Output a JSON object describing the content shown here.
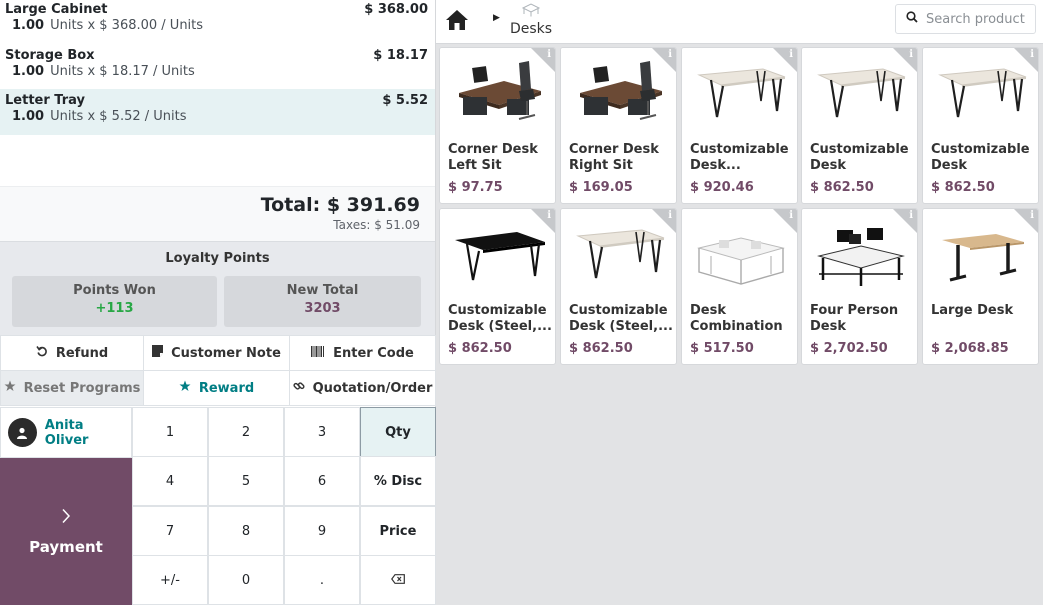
{
  "order": {
    "lines": [
      {
        "name": "Large Cabinet",
        "qty": "1.00",
        "unit_text": "Units x $ 368.00 / Units",
        "price": "$ 368.00"
      },
      {
        "name": "Storage Box",
        "qty": "1.00",
        "unit_text": "Units x $ 18.17 / Units",
        "price": "$ 18.17"
      },
      {
        "name": "Letter Tray",
        "qty": "1.00",
        "unit_text": "Units x $ 5.52 / Units",
        "price": "$ 5.52"
      }
    ],
    "selected_line": "Letter Tray",
    "total": "Total: $ 391.69",
    "taxes": "Taxes: $ 51.09"
  },
  "loyalty": {
    "title": "Loyalty Points",
    "points_won_label": "Points Won",
    "points_won_value": "+113",
    "new_total_label": "New Total",
    "new_total_value": "3203"
  },
  "controls": {
    "refund": "Refund",
    "customer_note": "Customer Note",
    "enter_code": "Enter Code",
    "reset_programs": "Reset Programs",
    "reward": "Reward",
    "quotation_order": "Quotation/Order"
  },
  "customer": {
    "name": "Anita Oliver"
  },
  "payment": {
    "label": "Payment"
  },
  "numpad": {
    "k1": "1",
    "k2": "2",
    "k3": "3",
    "qty": "Qty",
    "k4": "4",
    "k5": "5",
    "k6": "6",
    "disc": "% Disc",
    "k7": "7",
    "k8": "8",
    "k9": "9",
    "price": "Price",
    "plusminus": "+/-",
    "k0": "0",
    "dot": ".",
    "active_mode": "Qty"
  },
  "header": {
    "category": "Desks",
    "search_placeholder": "Search product"
  },
  "products": [
    {
      "name": "Corner Desk Left Sit",
      "price": "$ 97.75",
      "icon": "corner-desk-image"
    },
    {
      "name": "Corner Desk Right Sit",
      "price": "$ 169.05",
      "icon": "corner-desk-image"
    },
    {
      "name": "Customizable Desk...",
      "price": "$ 920.46",
      "icon": "desk-image"
    },
    {
      "name": "Customizable Desk (Custom...",
      "price": "$ 862.50",
      "icon": "desk-image"
    },
    {
      "name": "Customizable Desk (Custom...",
      "price": "$ 862.50",
      "icon": "desk-image"
    },
    {
      "name": "Customizable Desk (Steel,...",
      "price": "$ 862.50",
      "icon": "black-desk-image"
    },
    {
      "name": "Customizable Desk (Steel,...",
      "price": "$ 862.50",
      "icon": "desk-image"
    },
    {
      "name": "Desk Combination",
      "price": "$ 517.50",
      "icon": "desk-combination-image"
    },
    {
      "name": "Four Person Desk",
      "price": "$ 2,702.50",
      "icon": "four-person-desk-image"
    },
    {
      "name": "Large Desk",
      "price": "$ 2,068.85",
      "icon": "standing-desk-image"
    }
  ],
  "colors": {
    "brand": "#714b67",
    "teal": "#017e84",
    "points_won": "#28a745"
  }
}
